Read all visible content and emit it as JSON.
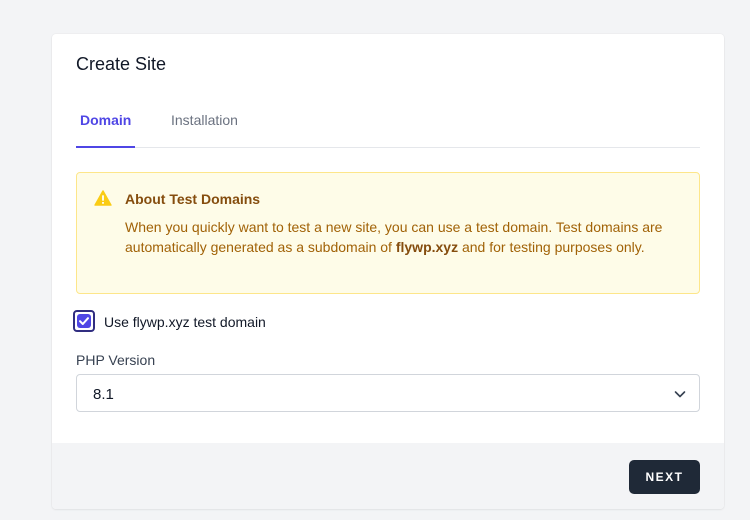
{
  "page": {
    "title": "Create Site"
  },
  "tabs": [
    {
      "label": "Domain",
      "active": true
    },
    {
      "label": "Installation",
      "active": false
    }
  ],
  "alert": {
    "icon": "warning-icon",
    "title": "About Test Domains",
    "text_before": "When you quickly want to test a new site, you can use a test domain. Test domains are automatically generated as a subdomain of ",
    "domain": "flywp.xyz",
    "text_after": " and for testing purposes only."
  },
  "test_domain": {
    "label": "Use flywp.xyz test domain",
    "checked": true
  },
  "php": {
    "label": "PHP Version",
    "value": "8.1"
  },
  "footer": {
    "next_label": "NEXT"
  },
  "colors": {
    "accent": "#4f46e5",
    "alert_bg": "#fefce8",
    "alert_border": "#fde68a",
    "alert_text": "#a16207",
    "button_bg": "#1f2937"
  }
}
